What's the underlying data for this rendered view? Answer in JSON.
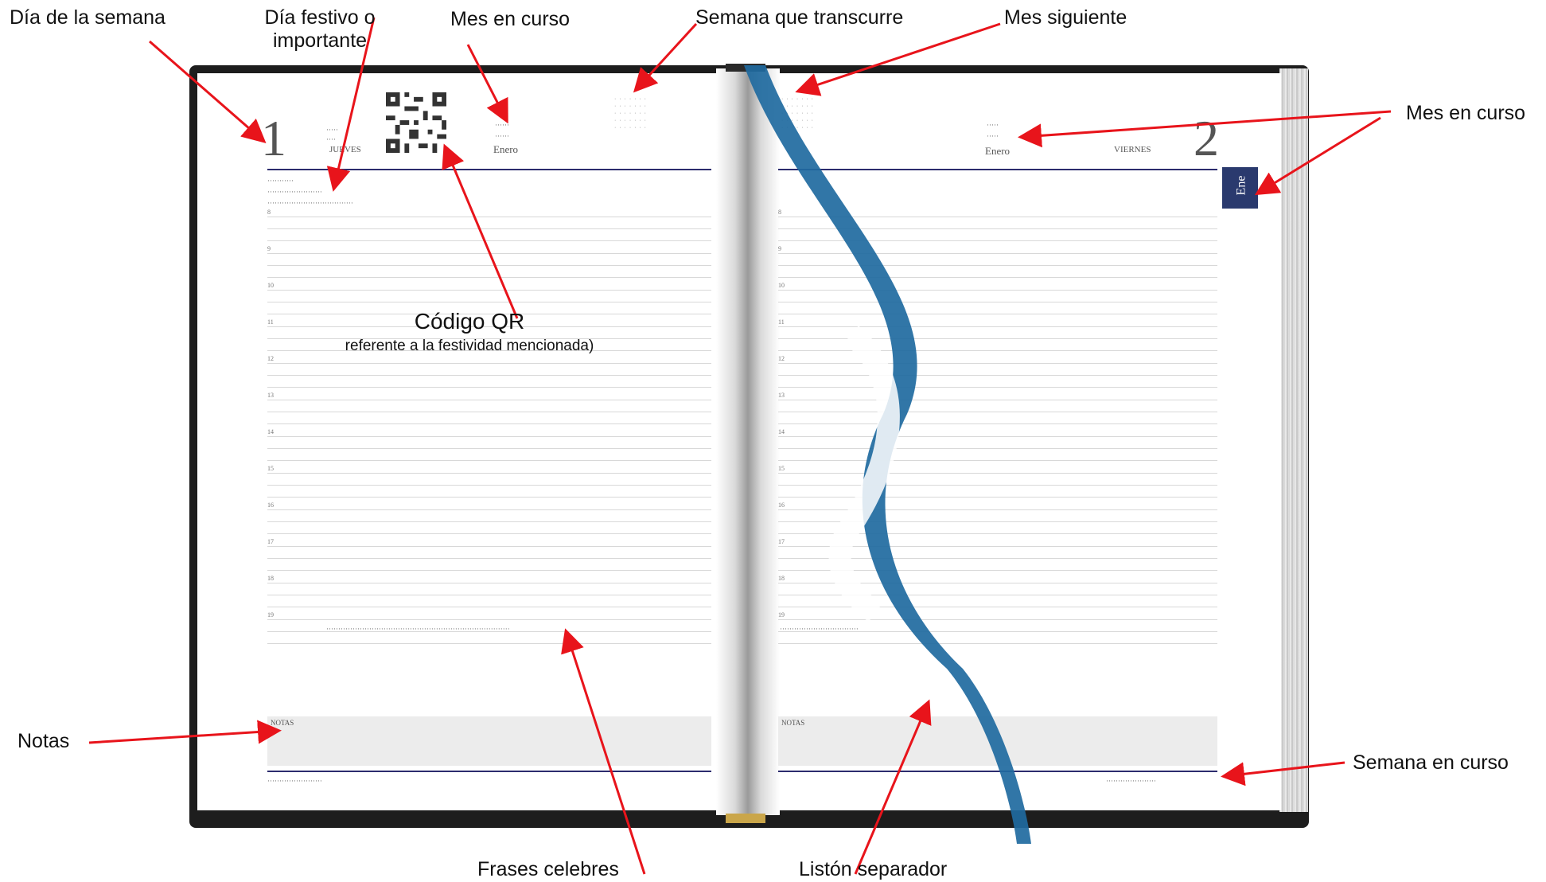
{
  "callouts": {
    "dia_semana": "Día de la semana",
    "dia_festivo_line1": "Día festivo o",
    "dia_festivo_line2": "importante",
    "mes_en_curso_top": "Mes en curso",
    "semana_transcurre": "Semana que transcurre",
    "mes_siguiente": "Mes siguiente",
    "mes_en_curso_right": "Mes en curso",
    "codigo_qr": "Código QR",
    "codigo_qr_sub": "referente a la festividad mencionada)",
    "notas": "Notas",
    "semana_en_curso": "Semana en curso",
    "frases_celebres": "Frases celebres",
    "liston_separador": "Listón separador"
  },
  "left_page": {
    "day_number": "1",
    "day_name": "JUEVES",
    "month": "Enero",
    "notes_label": "NOTAS"
  },
  "right_page": {
    "day_number": "2",
    "day_name": "VIERNES",
    "month": "Enero",
    "month_tab": "Ene",
    "notes_label": "NOTAS"
  },
  "left_hours": [
    "8",
    "9",
    "10",
    "11",
    "12",
    "13",
    "14",
    "15",
    "16",
    "17",
    "18",
    "19"
  ],
  "right_hours": [
    "8",
    "9",
    "10",
    "11",
    "12",
    "13",
    "14",
    "15",
    "16",
    "17",
    "18",
    "19"
  ],
  "colors": {
    "annotation_arrow": "#e8141b",
    "ribbon": "#1f6aa0",
    "header_rule": "#2c2c6e",
    "cover": "#1d1d1d",
    "month_tab": "#2a3a6e"
  }
}
